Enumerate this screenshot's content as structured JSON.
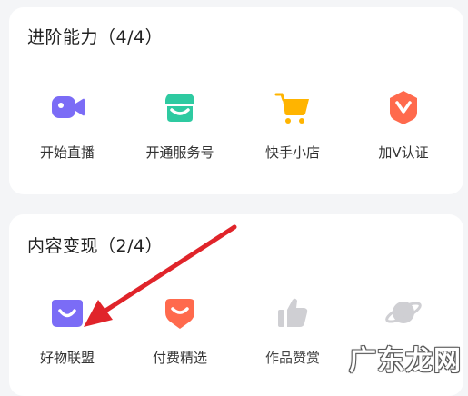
{
  "sections": [
    {
      "title": "进阶能力（4/4）",
      "items": [
        {
          "label": "开始直播",
          "icon": "video-camera-icon"
        },
        {
          "label": "开通服务号",
          "icon": "storefront-icon"
        },
        {
          "label": "快手小店",
          "icon": "shopping-cart-icon"
        },
        {
          "label": "加V认证",
          "icon": "verified-v-badge-icon"
        }
      ]
    },
    {
      "title": "内容变现（2/4）",
      "items": [
        {
          "label": "好物联盟",
          "icon": "shopping-bag-icon"
        },
        {
          "label": "付费精选",
          "icon": "paid-smile-icon"
        },
        {
          "label": "作品赞赏",
          "icon": "thumbs-up-icon"
        },
        {
          "label": "",
          "icon": "planet-icon"
        }
      ]
    }
  ],
  "colors": {
    "purple": "#7b6cf6",
    "teal": "#2ecaa1",
    "yellow": "#ffb400",
    "orange_red": "#ff6a4d",
    "gray_disabled": "#cfcfd3",
    "arrow_red": "#e0242a"
  },
  "watermark": "广东龙网"
}
